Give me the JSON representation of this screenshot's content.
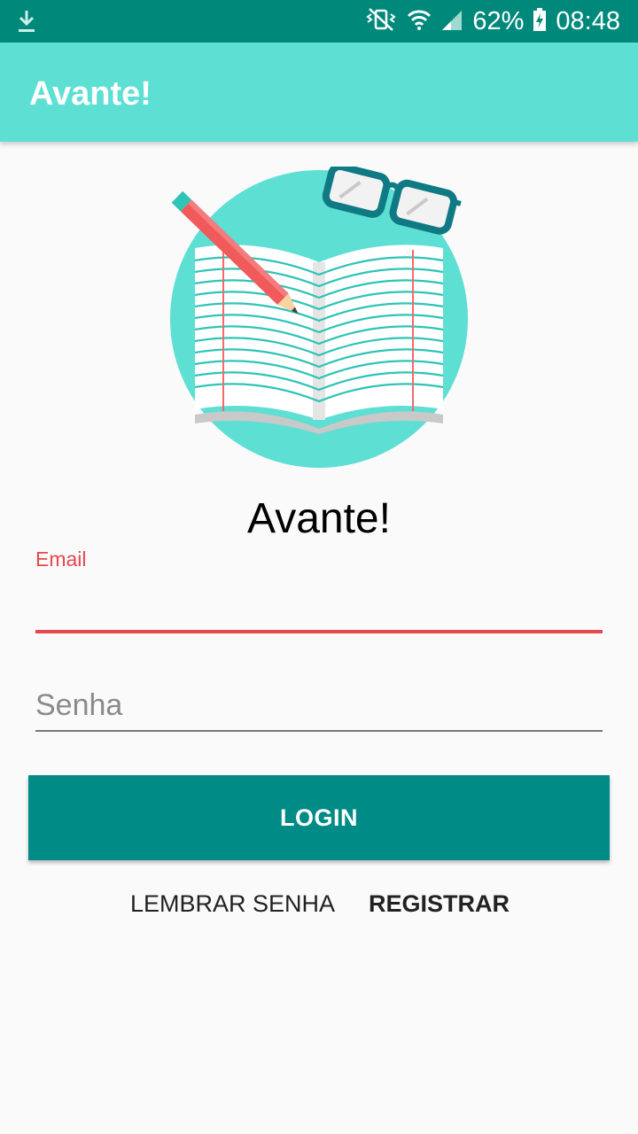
{
  "status_bar": {
    "battery": "62%",
    "time": "08:48",
    "icons": [
      "download-icon",
      "mute-vibrate-icon",
      "wifi-icon",
      "signal-icon",
      "battery-charging-icon"
    ]
  },
  "app_bar": {
    "title": "Avante!"
  },
  "main": {
    "logo_icon": "book-pencil-glasses-icon",
    "headline": "Avante!",
    "email": {
      "label": "Email",
      "value": ""
    },
    "password": {
      "placeholder": "Senha",
      "value": ""
    },
    "login_label": "LOGIN",
    "remember_label": "LEMBRAR SENHA",
    "register_label": "REGISTRAR"
  },
  "colors": {
    "status_bar": "#00897b",
    "app_bar": "#5edfd3",
    "accent_error": "#e5484d",
    "button": "#008b87"
  }
}
